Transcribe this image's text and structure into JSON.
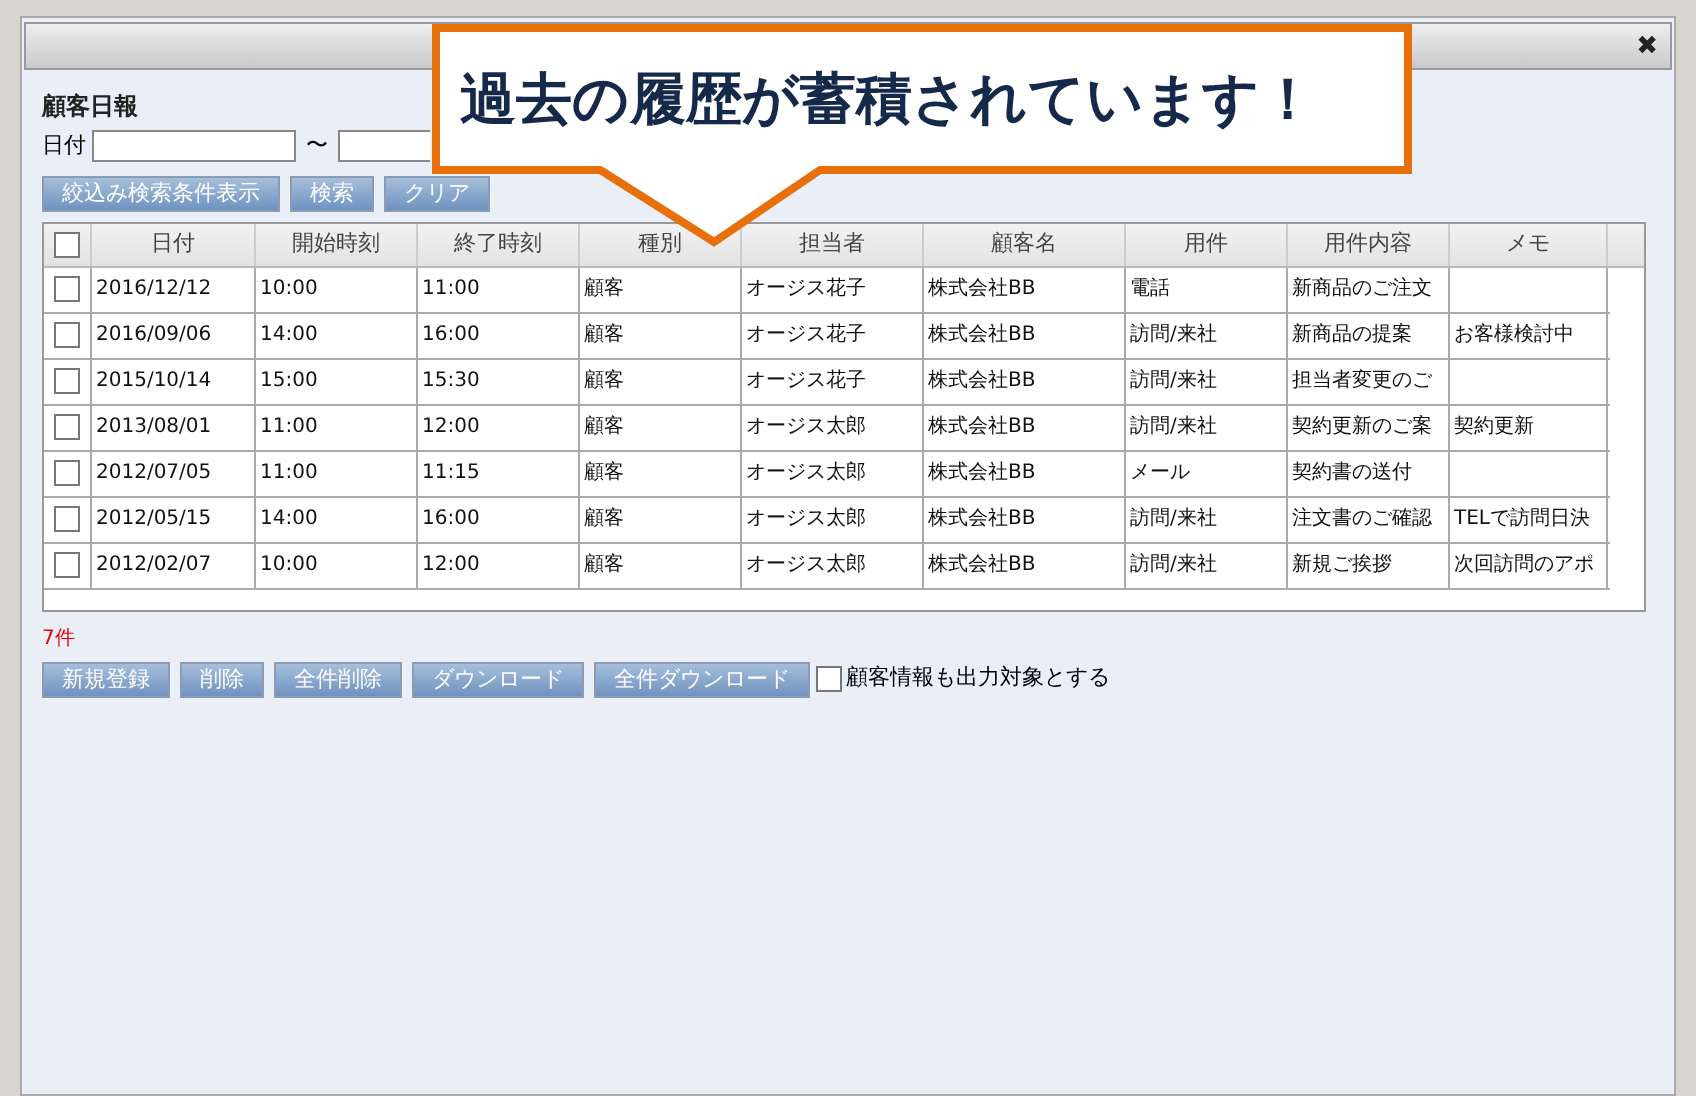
{
  "window": {
    "close": "✖"
  },
  "title": "顧客日報",
  "filter": {
    "label": "日付",
    "separator": "〜"
  },
  "filter_buttons": [
    "絞込み検索条件表示",
    "検索",
    "クリア"
  ],
  "table": {
    "select_all": {
      "checked": false
    },
    "columns": [
      "日付",
      "開始時刻",
      "終了時刻",
      "種別",
      "担当者",
      "顧客名",
      "用件",
      "用件内容",
      "メモ"
    ],
    "rows": [
      {
        "checked": false,
        "cells": [
          "2016/12/12",
          "10:00",
          "11:00",
          "顧客",
          "オージス花子",
          "株式会社BB",
          "電話",
          "新商品のご注文",
          ""
        ]
      },
      {
        "checked": false,
        "cells": [
          "2016/09/06",
          "14:00",
          "16:00",
          "顧客",
          "オージス花子",
          "株式会社BB",
          "訪問/来社",
          "新商品の提案",
          "お客様検討中"
        ]
      },
      {
        "checked": false,
        "cells": [
          "2015/10/14",
          "15:00",
          "15:30",
          "顧客",
          "オージス花子",
          "株式会社BB",
          "訪問/来社",
          "担当者変更のご",
          ""
        ]
      },
      {
        "checked": false,
        "cells": [
          "2013/08/01",
          "11:00",
          "12:00",
          "顧客",
          "オージス太郎",
          "株式会社BB",
          "訪問/来社",
          "契約更新のご案",
          "契約更新"
        ]
      },
      {
        "checked": false,
        "cells": [
          "2012/07/05",
          "11:00",
          "11:15",
          "顧客",
          "オージス太郎",
          "株式会社BB",
          "メール",
          "契約書の送付",
          ""
        ]
      },
      {
        "checked": false,
        "cells": [
          "2012/05/15",
          "14:00",
          "16:00",
          "顧客",
          "オージス太郎",
          "株式会社BB",
          "訪問/来社",
          "注文書のご確認",
          "TELで訪問日決"
        ]
      },
      {
        "checked": false,
        "cells": [
          "2012/02/07",
          "10:00",
          "12:00",
          "顧客",
          "オージス太郎",
          "株式会社BB",
          "訪問/来社",
          "新規ご挨拶",
          "次回訪問のアポ"
        ]
      }
    ]
  },
  "count": "7件",
  "action_buttons": [
    "新規登録",
    "削除",
    "全件削除",
    "ダウンロード",
    "全件ダウンロード"
  ],
  "include_customer": {
    "label": "顧客情報も出力対象とする",
    "checked": false
  },
  "callout": {
    "text": "過去の履歴が蓄積されています！"
  }
}
